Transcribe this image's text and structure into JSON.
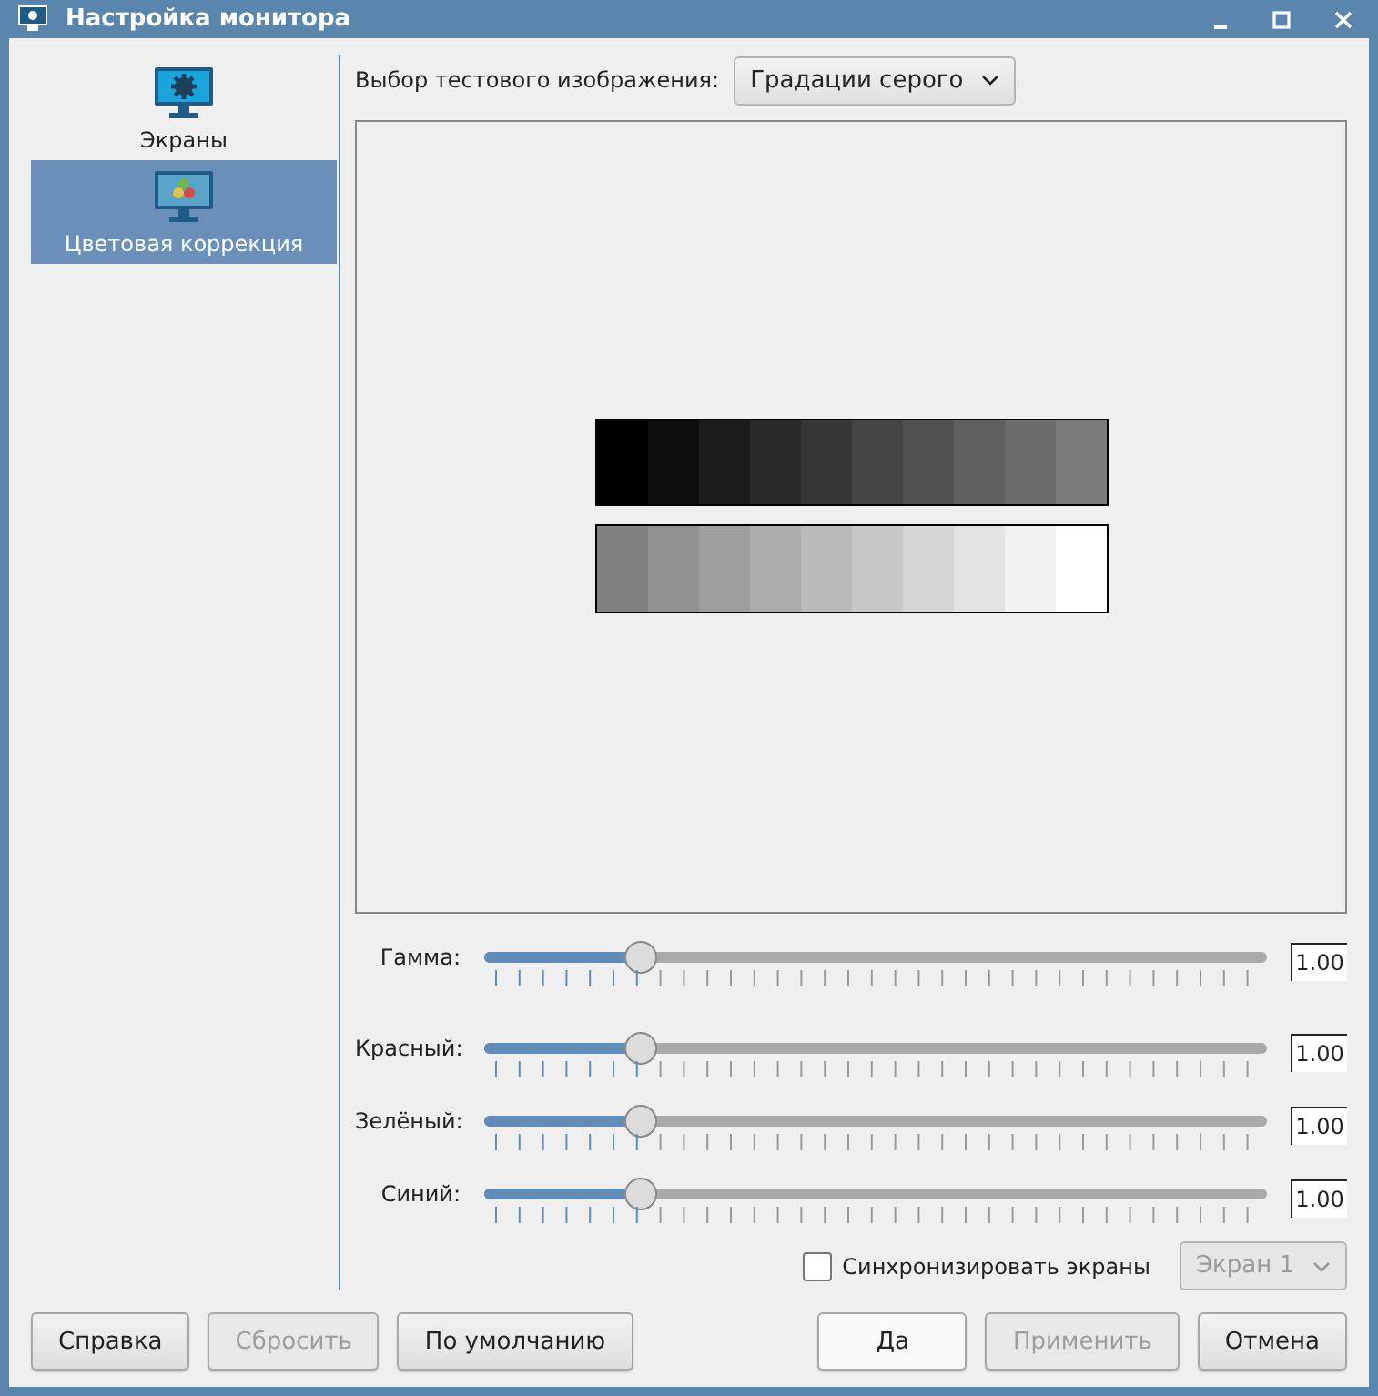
{
  "window": {
    "title": "Настройка монитора"
  },
  "sidebar": {
    "items": [
      {
        "label": "Экраны",
        "kind": "screens",
        "selected": false
      },
      {
        "label": "Цветовая коррекция",
        "kind": "color",
        "selected": true
      }
    ]
  },
  "test_image": {
    "label": "Выбор тестового изображения:",
    "value": "Градации серого"
  },
  "sliders": [
    {
      "label": "Гамма:",
      "level": 0.2,
      "reading": "1.00"
    },
    {
      "label": "Красный:",
      "level": 0.2,
      "reading": "1.00"
    },
    {
      "label": "Зелёный:",
      "level": 0.2,
      "reading": "1.00"
    },
    {
      "label": "Синий:",
      "level": 0.2,
      "reading": "1.00"
    }
  ],
  "sync": {
    "label": "Синхронизировать экраны",
    "checked": false
  },
  "screen_select": {
    "value": "Экран 1",
    "disabled": true
  },
  "buttons_left": [
    {
      "label": "Справка",
      "disabled": false
    },
    {
      "label": "Сбросить",
      "disabled": true
    },
    {
      "label": "По умолчанию",
      "disabled": false
    }
  ],
  "buttons_right": [
    {
      "label": "Да",
      "disabled": false,
      "default": true
    },
    {
      "label": "Применить",
      "disabled": true,
      "default": false
    },
    {
      "label": "Отмена",
      "disabled": false,
      "default": false
    }
  ]
}
